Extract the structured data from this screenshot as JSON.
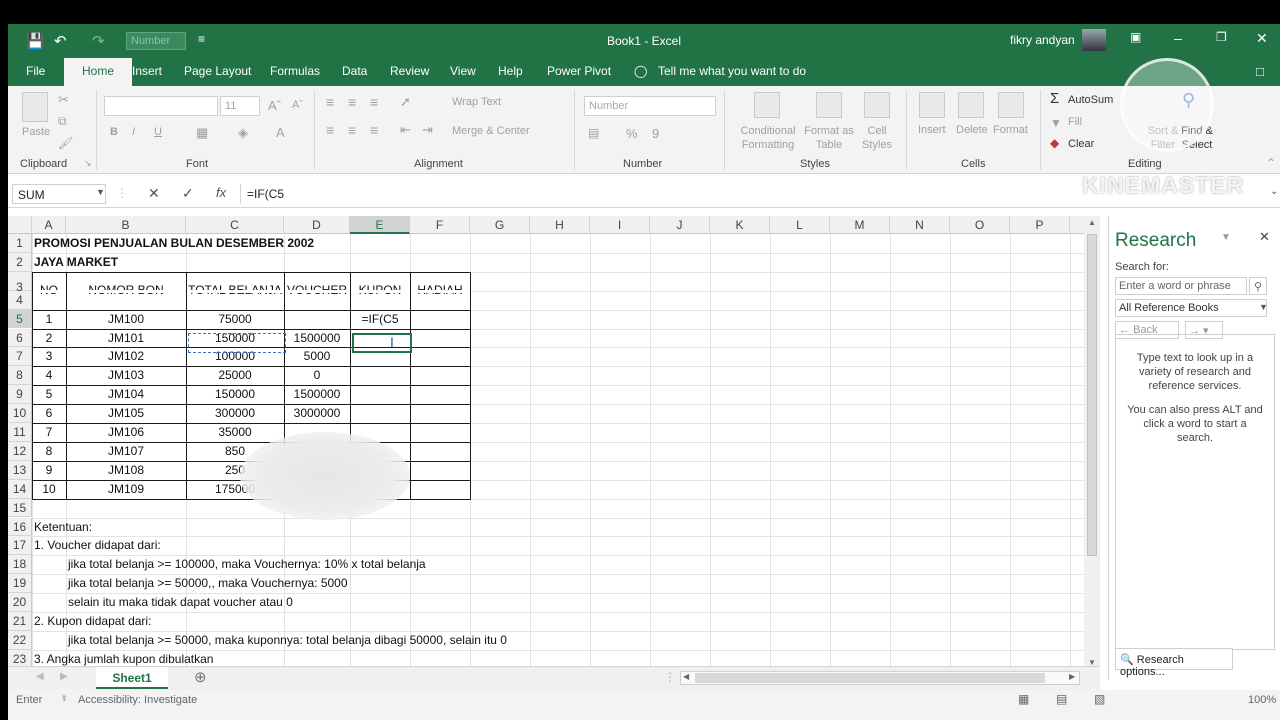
{
  "title_bar": {
    "doc_title": "Book1 - Excel",
    "user": "fikry andyan",
    "number_format_box": "Number"
  },
  "tabs": [
    "File",
    "Home",
    "Insert",
    "Page Layout",
    "Formulas",
    "Data",
    "Review",
    "View",
    "Help",
    "Power Pivot"
  ],
  "tell_me": "Tell me what you want to do",
  "ribbon": {
    "clipboard": {
      "label": "Clipboard",
      "paste": "Paste"
    },
    "font": {
      "label": "Font",
      "size": "11",
      "bold": "B",
      "italic": "I",
      "underline": "U"
    },
    "alignment": {
      "label": "Alignment",
      "wrap": "Wrap Text",
      "merge": "Merge & Center"
    },
    "number": {
      "label": "Number",
      "format": "Number",
      "percent": "%",
      "comma": "9"
    },
    "styles": {
      "label": "Styles",
      "conditional": "Conditional Formatting",
      "format_as_table": "Format as Table",
      "cell_styles": "Cell Styles"
    },
    "cells": {
      "label": "Cells",
      "insert": "Insert",
      "delete": "Delete",
      "format": "Format"
    },
    "editing": {
      "label": "Editing",
      "autosum": "AutoSum",
      "fill": "Fill",
      "clear": "Clear",
      "sort_filter": "Sort & Filter",
      "find_select": "Find & Select"
    }
  },
  "formula_bar": {
    "name_box": "SUM",
    "formula": "=IF(C5",
    "cancel": "✕",
    "enter": "✓",
    "fx": "fx"
  },
  "columns": [
    "A",
    "B",
    "C",
    "D",
    "E",
    "F",
    "G",
    "H",
    "I",
    "J",
    "K",
    "L",
    "M",
    "N",
    "O",
    "P"
  ],
  "rows": [
    "1",
    "2",
    "3",
    "4",
    "5",
    "6",
    "7",
    "8",
    "9",
    "10",
    "11",
    "12",
    "13",
    "14",
    "15",
    "16",
    "17",
    "18",
    "19",
    "20",
    "21",
    "22",
    "23"
  ],
  "sheet": {
    "title1": "PROMOSI PENJUALAN BULAN DESEMBER 2002",
    "title2": "JAYA MARKET",
    "headers": [
      "NO",
      "NOMOR BON",
      "TOTAL BELANJA",
      "VOUCHER",
      "KUPON",
      "HADIAH"
    ],
    "table": [
      {
        "no": "1",
        "bon": "JM100",
        "total": "75000",
        "voucher": "",
        "kupon": "=IF(C5"
      },
      {
        "no": "2",
        "bon": "JM101",
        "total": "150000",
        "voucher": "1500000",
        "kupon": ""
      },
      {
        "no": "3",
        "bon": "JM102",
        "total": "100000",
        "voucher": "5000",
        "kupon": ""
      },
      {
        "no": "4",
        "bon": "JM103",
        "total": "25000",
        "voucher": "0",
        "kupon": ""
      },
      {
        "no": "5",
        "bon": "JM104",
        "total": "150000",
        "voucher": "1500000",
        "kupon": ""
      },
      {
        "no": "6",
        "bon": "JM105",
        "total": "300000",
        "voucher": "3000000",
        "kupon": ""
      },
      {
        "no": "7",
        "bon": "JM106",
        "total": "35000",
        "voucher": "",
        "kupon": ""
      },
      {
        "no": "8",
        "bon": "JM107",
        "total": "850",
        "voucher": "",
        "kupon": ""
      },
      {
        "no": "9",
        "bon": "JM108",
        "total": "250",
        "voucher": "",
        "kupon": ""
      },
      {
        "no": "10",
        "bon": "JM109",
        "total": "175000",
        "voucher": "",
        "kupon": ""
      }
    ],
    "notes": [
      "Ketentuan:",
      "1. Voucher didapat dari:",
      "jika total belanja >= 100000, maka Vouchernya: 10% x total belanja",
      "jika total belanja >= 50000,, maka Vouchernya: 5000",
      "selain itu maka tidak dapat voucher atau 0",
      "2. Kupon didapat dari:",
      "jika total belanja >= 50000, maka kuponnya: total belanja dibagi 50000, selain itu 0",
      "3. Angka jumlah kupon dibulatkan"
    ]
  },
  "sheet_tab": "Sheet1",
  "status": {
    "mode": "Enter",
    "accessibility": "Accessibility: Investigate",
    "zoom": "100%"
  },
  "research": {
    "title": "Research",
    "search_for": "Search for:",
    "search_placeholder": "Enter a word or phrase",
    "source": "All Reference Books",
    "back": "Back",
    "help1": "Type text to look up in a variety of research and reference services.",
    "help2": "You can also press ALT and click a word to start a search.",
    "options": "Research options..."
  },
  "watermark": "KINEMASTER"
}
